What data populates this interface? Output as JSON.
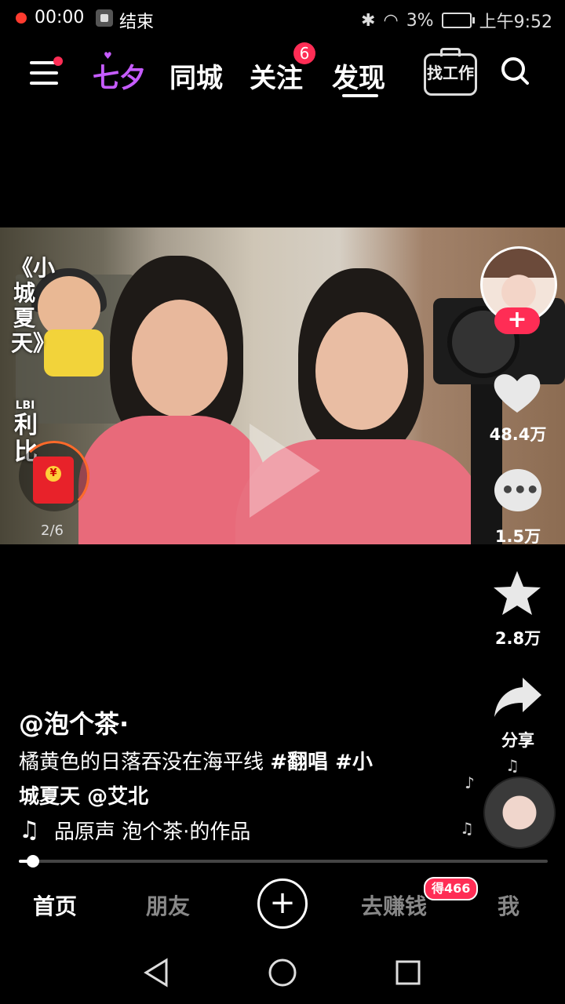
{
  "status_bar": {
    "record_time": "00:00",
    "stop_label": "结束",
    "battery": "3%",
    "time": "上午9:52"
  },
  "top_nav": {
    "tabs": [
      {
        "label": "七夕"
      },
      {
        "label": "同城"
      },
      {
        "label": "关注",
        "badge": "6"
      },
      {
        "label": "发现",
        "active": true
      }
    ],
    "job_label": "找工作"
  },
  "video": {
    "song_title_vertical": "《小城夏天》",
    "song_credit_small": "LBI",
    "song_credit": "利比",
    "redpacket_progress": "2/6",
    "redpacket_symbol": "¥"
  },
  "right_rail": {
    "likes": "48.4万",
    "comments": "1.5万",
    "favorites": "2.8万",
    "share": "分享",
    "follow_plus": "+"
  },
  "caption": {
    "author": "@泡个茶·",
    "text": "橘黄色的日落吞没在海平线 ",
    "tag1": "#翻唱",
    "tag2": " #小",
    "line2_tag": "城夏天",
    "mention": " @艾北"
  },
  "music": {
    "note": "♫",
    "text": "品原声    泡个茶·的作品"
  },
  "progress": {
    "fraction": 0.02
  },
  "bottom_tabs": {
    "home": "首页",
    "friends": "朋友",
    "create": "+",
    "earn": "去赚钱",
    "earn_badge": "得466",
    "me": "我"
  },
  "colors": {
    "accent": "#ff2d55",
    "qixi": "#c65cff"
  }
}
